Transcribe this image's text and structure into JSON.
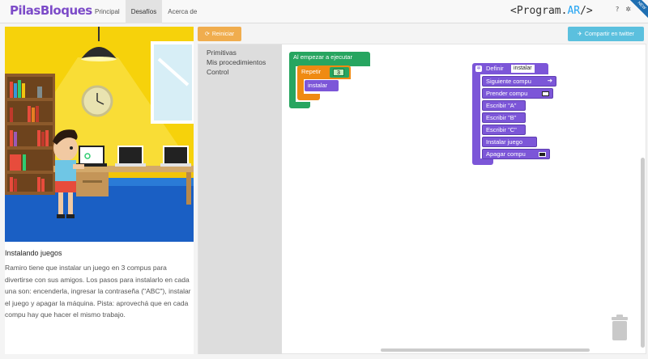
{
  "app": {
    "logo_text": "PilasBloques",
    "brand_prefix": "<Program.",
    "brand_ar": "AR",
    "brand_suffix": "/>",
    "help_icon_text": "?",
    "settings_icon_text": "✲",
    "new_badge": "NEW"
  },
  "nav": {
    "items": [
      {
        "label": "Principal"
      },
      {
        "label": "Desafíos"
      },
      {
        "label": "Acerca de"
      }
    ]
  },
  "toolbar": {
    "reset_label": "Reiniciar",
    "share_label": "Compartir en twitter"
  },
  "challenge": {
    "title": "Instalando juegos",
    "description": "Ramiro tiene que instalar un juego en 3 compus para divertirse con sus amigos. Los pasos para instalarlo en cada una son: encenderla, ingresar la contraseña (\"ABC\"), instalar el juego y apagar la máquina. Pista: aprovechá que en cada compu hay que hacer el mismo trabajo."
  },
  "toolbox": {
    "categories": [
      "Primitivas",
      "Mis procedimientos",
      "Control"
    ]
  },
  "blocks": {
    "start_label": "Al empezar a ejecutar",
    "repeat_label": "Repetir",
    "repeat_count": "3",
    "call_label": "instalar",
    "define_label": "Definir",
    "define_name": "instalar",
    "steps": [
      "Siguiente compu",
      "Prender compu",
      "Escribir \"A\"",
      "Escribir \"B\"",
      "Escribir \"C\"",
      "Instalar juego",
      "Apagar compu"
    ]
  },
  "colors": {
    "start": "#27a560",
    "repeat": "#ef8a12",
    "procedure": "#7c56d8",
    "accent": "#1da1f2"
  }
}
